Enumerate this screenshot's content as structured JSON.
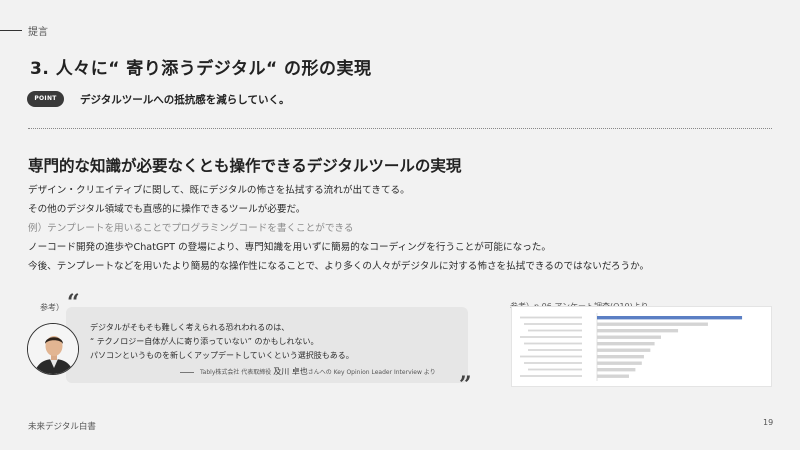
{
  "section": {
    "label": "提言"
  },
  "title": "3. 人々に“ 寄り添うデジタル“ の形の実現",
  "point": {
    "badge": "POINT",
    "text": "デジタルツールへの抵抗感を減らしていく。"
  },
  "headline": "専門的な知識が必要なくとも操作できるデジタルツールの実現",
  "body": [
    {
      "text": "デザイン・クリエイティブに関して、既にデジタルの怖さを払拭する流れが出てきてる。",
      "muted": false
    },
    {
      "text": "その他のデジタル領域でも直感的に操作できるツールが必要だ。",
      "muted": false
    },
    {
      "text": "例）テンプレートを用いることでプログラミングコードを書くことができる",
      "muted": true
    },
    {
      "text": "ノーコード開発の進歩やChatGPT の登場により、専門知識を用いずに簡易的なコーディングを行うことが可能になった。",
      "muted": false
    },
    {
      "text": "今後、テンプレートなどを用いたより簡易的な操作性になることで、より多くの人々がデジタルに対する怖さを払拭できるのではないだろうか。",
      "muted": false
    }
  ],
  "quote": {
    "ref_label": "参考）",
    "open_mark": "“",
    "close_mark": "”",
    "lines": [
      "デジタルがそもそも難しく考えられる恐れわれるのは、",
      "“ テクノロジー自体が人に寄り添っていない” のかもしれない。",
      "パソコンというものを新しくアップデートしていくという選択肢もある。"
    ],
    "attribution_prefix": "Tably株式会社 代表取締役",
    "attribution_name": "及川 卓也",
    "attribution_suffix": "さんへの Key Opinion Leader Interview より"
  },
  "reference": {
    "label": "参考）p.06 アンケート調査(Q10)より"
  },
  "chart_data": {
    "type": "bar",
    "orientation": "horizontal",
    "values": [
      68,
      52,
      38,
      30,
      27,
      25,
      22,
      21,
      18,
      15
    ],
    "highlight_index": 0,
    "colors": {
      "highlight": "#5b7fc4",
      "default": "#d4d4d4"
    }
  },
  "footer": {
    "text": "未来デジタル白書",
    "page": "19"
  }
}
